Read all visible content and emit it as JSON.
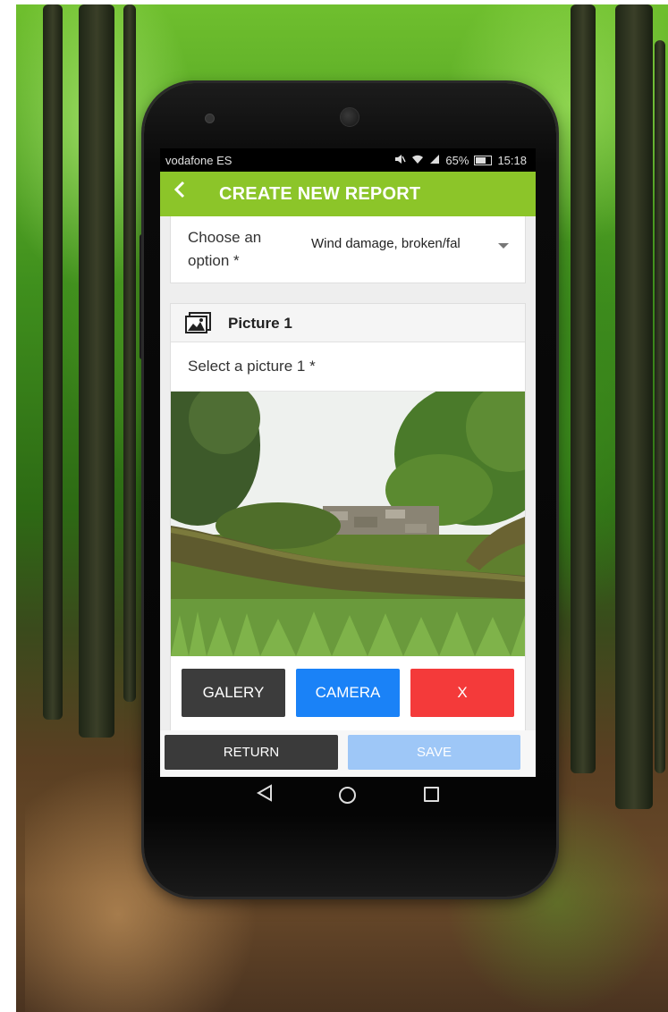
{
  "status_bar": {
    "carrier": "vodafone ES",
    "battery": "65%",
    "time": "15:18",
    "icons": [
      "mute-icon",
      "wifi-icon",
      "signal-icon",
      "battery-icon"
    ]
  },
  "app_bar": {
    "title": "CREATE NEW REPORT",
    "back_icon": "chevron-left-icon",
    "color": "#8cc529"
  },
  "option_field": {
    "label": "Choose an option *",
    "selected_value": "Wind damage, broken/fal"
  },
  "picture_section": {
    "title": "Picture 1",
    "prompt": "Select a picture 1 *",
    "icon": "gallery-icon",
    "photo_description_icon": "fallen-tree-photo"
  },
  "picture_buttons": {
    "galery": "GALERY",
    "camera": "CAMERA",
    "clear": "X",
    "colors": {
      "galery": "#3c3c3c",
      "camera": "#1a82f7",
      "clear": "#f43a3a"
    }
  },
  "footer": {
    "return": "RETURN",
    "save": "SAVE"
  },
  "nav_bar": {
    "icons": [
      "back-triangle-icon",
      "home-circle-icon",
      "recents-square-icon"
    ]
  }
}
